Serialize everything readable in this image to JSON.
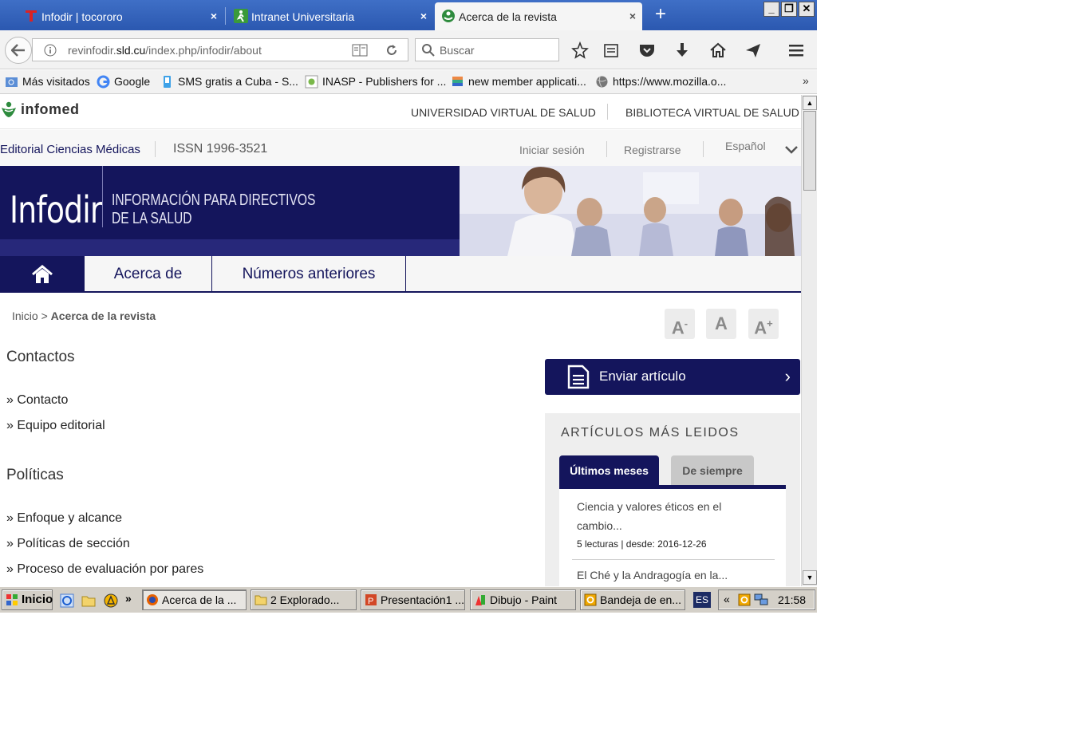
{
  "browser": {
    "tabs": [
      {
        "title": "Infodir | tocororo",
        "close": "×"
      },
      {
        "title": "Intranet Universitaria",
        "close": "×"
      },
      {
        "title": "Acerca de la revista",
        "close": "×"
      }
    ],
    "new_tab": "+",
    "window_buttons": [
      "_",
      "❐",
      "✕"
    ],
    "url_prefix": "revinfodir.",
    "url_domain": "sld.cu",
    "url_suffix": "/index.php/infodir/about",
    "search_placeholder": "Buscar",
    "bookmarks": [
      "Más visitados",
      "Google",
      "SMS gratis a Cuba - S...",
      "INASP - Publishers for ...",
      "new member applicati...",
      "https://www.mozilla.o..."
    ],
    "bookmarks_more": "»"
  },
  "site": {
    "logo_text": "infomed",
    "top_links": [
      "UNIVERSIDAD VIRTUAL DE SALUD",
      "BIBLIOTECA VIRTUAL DE SALUD"
    ],
    "publisher": "Editorial Ciencias Médicas",
    "issn": "ISSN 1996-3521",
    "login": "Iniciar sesión",
    "register": "Registrarse",
    "language": "Español",
    "banner_title": "Infodir",
    "banner_sub1": "INFORMACIÓN PARA DIRECTIVOS",
    "banner_sub2": "DE LA SALUD",
    "nav": [
      "Acerca de",
      "Números anteriores"
    ],
    "breadcrumb_home": "Inicio",
    "breadcrumb_sep": ">",
    "breadcrumb_current": "Acerca de la revista",
    "font_buttons": {
      "smaller": "A",
      "normal": "A",
      "larger": "A",
      "minus": "-",
      "plus": "+"
    },
    "contacts_heading": "Contactos",
    "contacts_links": [
      "» Contacto",
      "» Equipo editorial"
    ],
    "policies_heading": "Políticas",
    "policies_links": [
      "» Enfoque y alcance",
      "» Políticas de sección",
      "» Proceso de evaluación por pares"
    ],
    "submit_label": "Enviar artículo",
    "submit_chevron": "›",
    "most_read_title": "ARTÍCULOS MÁS LEIDOS",
    "most_read_tabs": [
      "Últimos meses",
      "De siempre"
    ],
    "articles": [
      {
        "title": "Ciencia y valores éticos en el cambio...",
        "meta": "5 lecturas | desde: 2016-12-26"
      },
      {
        "title": "El Ché y la Andragogía en la...",
        "meta": ""
      }
    ]
  },
  "taskbar": {
    "start": "Inicio",
    "tasks": [
      "Acerca de la ...",
      "2 Explorado...",
      "Presentación1 ...",
      "Dibujo - Paint",
      "Bandeja de en..."
    ],
    "lang": "ES",
    "tray_arrow": "«",
    "clock": "21:58"
  },
  "colors": {
    "brand_navy": "#14155c",
    "infomed_green": "#2e8b3e",
    "tabstrip_blue": "#2b58b0"
  }
}
